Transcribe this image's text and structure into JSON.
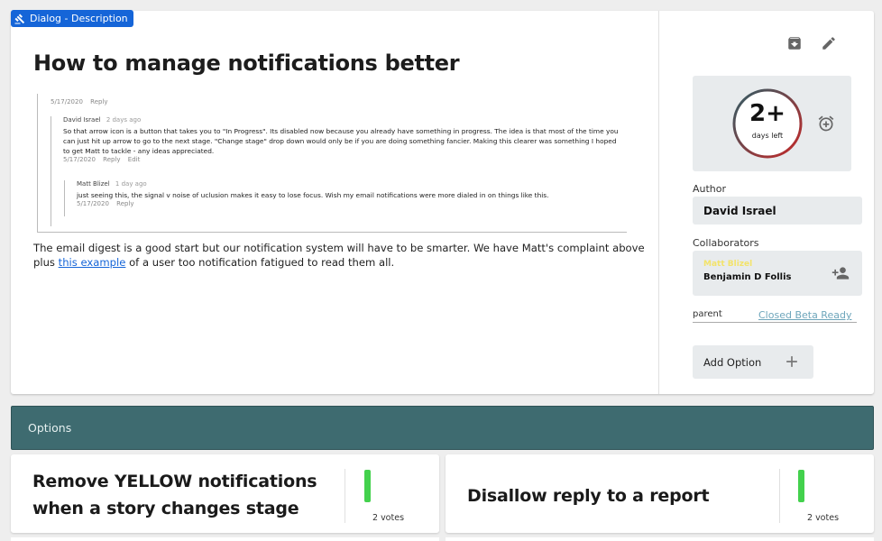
{
  "dialog_tag": {
    "label": "Dialog - Description",
    "icon": "gavel-icon"
  },
  "story": {
    "title": "How to manage notifications better",
    "thread": {
      "root_meta": {
        "date": "5/17/2020",
        "reply": "Reply"
      },
      "comments": [
        {
          "author": "David Israel",
          "ago": "2 days ago",
          "text": "So that arrow icon is a button that takes you to \"In Progress\". Its disabled now because you already have something in progress. The idea is that most of the time you can just hit up arrow to go to the next stage. \"Change stage\" drop down would only be if you are doing something fancier. Making this clearer was something I hoped to get Matt to tackle - any ideas appreciated.",
          "date": "5/17/2020",
          "reply": "Reply",
          "edit": "Edit"
        },
        {
          "author": "Matt Blizel",
          "ago": "1 day ago",
          "text": "just seeing this, the signal v noise of uclusion makes it easy to lose focus. Wish my email notifications were more dialed in on things like this.",
          "date": "5/17/2020",
          "reply": "Reply"
        }
      ]
    },
    "body": {
      "before_link": "The email digest is a good start but our notification system will have to be smarter. We have Matt's complaint above plus ",
      "link_text": "this example",
      "after_link": " of a user too notification fatigued to read them all."
    }
  },
  "sidebar": {
    "archive_icon": "archive-icon",
    "edit_icon": "pencil-icon",
    "countdown": {
      "value": "2+",
      "caption": "days left",
      "alarm_icon": "alarm-add-icon"
    },
    "author_label": "Author",
    "author_value": "David Israel",
    "collaborators_label": "Collaborators",
    "collaborators": [
      "Matt Blizel",
      "Benjamin D Follis"
    ],
    "add_person_icon": "person-add-icon",
    "parent_label": "parent",
    "parent_link": "Closed Beta Ready",
    "add_option_label": "Add Option"
  },
  "options": {
    "header": "Options",
    "cards": [
      {
        "title_line1": "Remove YELLOW notifications",
        "title_line2": "when a story changes stage",
        "votes": "2 votes"
      },
      {
        "title": "Disallow reply to a report",
        "votes": "2 votes"
      }
    ]
  },
  "colors": {
    "accent": "#1565d8",
    "options_bar": "#3e6b70",
    "vote": "#43d14d",
    "ring_start": "#2e5d66",
    "ring_end": "#c62828"
  }
}
